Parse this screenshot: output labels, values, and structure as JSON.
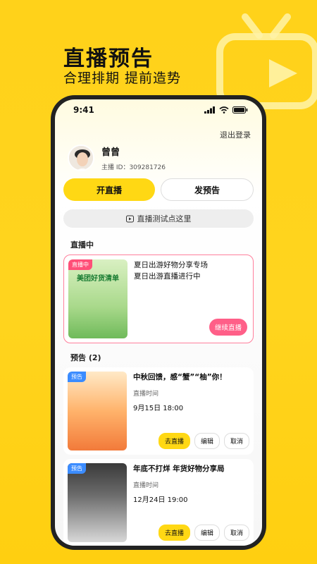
{
  "hero": {
    "title": "直播预告",
    "subtitle": "合理排期 提前造势"
  },
  "status_bar": {
    "time": "9:41"
  },
  "header": {
    "logout": "退出登录"
  },
  "profile": {
    "name": "曾曾",
    "id_label": "主播 ID：309281726"
  },
  "buttons": {
    "start_live": "开直播",
    "publish_preview": "发预告"
  },
  "test_bar": {
    "label": "直播测试点这里"
  },
  "live_section": {
    "title": "直播中",
    "card": {
      "badge": "直播中",
      "thumb_text": "美团好货清单",
      "title_line1": "夏日出游好物分享专场",
      "title_line2": "夏日出游直播进行中",
      "action": "继续直播"
    }
  },
  "preview_section": {
    "title": "预告 (2)",
    "items": [
      {
        "badge": "预告",
        "title": "中秋回馈，感“蟹”“柚”你！",
        "time_label": "直播时间",
        "time": "9月15日 18:00",
        "actions": [
          "去直播",
          "编辑",
          "取消"
        ]
      },
      {
        "badge": "预告",
        "title": "年底不打烊 年货好物分享局",
        "time_label": "直播时间",
        "time": "12月24日 19:00",
        "actions": [
          "去直播",
          "编辑",
          "取消"
        ]
      }
    ]
  },
  "colors": {
    "accent": "#ffd814",
    "live_pink": "#ff5f88",
    "background": "#ffd21a"
  }
}
